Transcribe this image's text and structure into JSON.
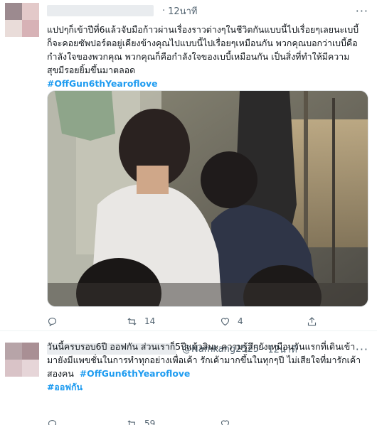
{
  "tweets": [
    {
      "time": "12นาที",
      "more": "···",
      "lines": [
        "แปปๆก็เข้าปีที่6แล้วจับมือก้าวผ่านเรื่องราวต่างๆในชีวิตกันแบบนี้ไปเรื่อยๆเลยนะเบบี้",
        "ก็จะคอยซัพปอร์ตอยู่เคียงข้างคุณไปแบบนี้ไปเรื่อยๆเหมือนกัน พวกคุณบอกว่าเบบี้คือ",
        "กำลังใจของพวกคุณ พวกคุณก็คือกำลังใจของเบบี้เหมือนกัน เป็นสิ่งที่ทำให้มีความ",
        "สุขมีรอยยิ้มขึ้นมาตลอด"
      ],
      "hashtag": "#OffGun6thYearoflove",
      "stats": {
        "reply": "",
        "retweet": "14",
        "like": "4",
        "share": ""
      }
    },
    {
      "handle": "@Namkang2525",
      "time": "12นาที",
      "more": "···",
      "lines": [
        "วันนี้ครบรอบ6ปี ออฟกัน ส่วนเราก็5ปีแล้วสินะ ความรู้สึกยังเหมือนวันแรกที่เดินเข้า",
        "มายังมีแพขชั่นในการทำทุกอย่างเพื่อเค้า รักเค้ามากขึ้นในทุกๆปี ไม่เสียใจที่มารักเค้า",
        "สองคน"
      ],
      "hashtag": "#OffGun6thYearoflove",
      "hashtag2": "#ออฟกัน",
      "stats": {
        "reply": "",
        "retweet": "59",
        "like": ""
      }
    }
  ],
  "colors": {
    "accent": "#1d9bf0",
    "muted": "#536471",
    "text": "#0f1419"
  },
  "icons": [
    "reply-icon",
    "retweet-icon",
    "like-icon",
    "share-icon",
    "more-icon"
  ]
}
